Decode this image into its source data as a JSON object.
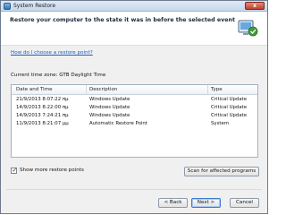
{
  "window": {
    "title": "System Restore",
    "close_label": "x"
  },
  "header": {
    "instruction": "Restore your computer to the state it was in before the selected event"
  },
  "help_link": "How do I choose a restore point?",
  "timezone": "Current time zone: GTB Daylight Time",
  "table": {
    "columns": [
      "Date and Time",
      "Description",
      "Type"
    ],
    "rows": [
      {
        "date": "21/9/2013 8:07:22 πμ",
        "description": "Windows Update",
        "type": "Critical Update"
      },
      {
        "date": "14/9/2013 8:22:00 πμ",
        "description": "Windows Update",
        "type": "Critical Update"
      },
      {
        "date": "14/9/2013 7:24:21 πμ",
        "description": "Windows Update",
        "type": "Critical Update"
      },
      {
        "date": "11/9/2013 8:21:07 μμ",
        "description": "Automatic Restore Point",
        "type": "System"
      }
    ]
  },
  "show_more": {
    "label": "Show more restore points",
    "checked": true
  },
  "buttons": {
    "scan": "Scan for affected programs",
    "back": "< Back",
    "next": "Next >",
    "cancel": "Cancel"
  }
}
